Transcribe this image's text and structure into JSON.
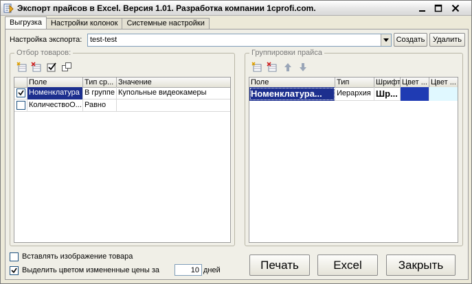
{
  "window": {
    "title": "Экспорт прайсов в Excel. Версия 1.01. Разработка компании 1cprofi.com."
  },
  "tabs": [
    {
      "label": "Выгрузка",
      "active": true
    },
    {
      "label": "Настройки колонок",
      "active": false
    },
    {
      "label": "Системные настройки",
      "active": false
    }
  ],
  "export_settings": {
    "label": "Настройка экспорта:",
    "value": "test-test",
    "create_label": "Создать",
    "delete_label": "Удалить"
  },
  "filter": {
    "title": "Отбор товаров:",
    "toolbar_icons": [
      "add-row-icon",
      "delete-row-icon",
      "check-all-icon",
      "copy-icon"
    ],
    "columns": [
      "Поле",
      "Тип ср...",
      "Значение"
    ],
    "rows": [
      {
        "checked": true,
        "field": "Номенклатура",
        "type": "В группе",
        "value": "Купольные видеокамеры",
        "selected": true
      },
      {
        "checked": false,
        "field": "КоличествоО...",
        "type": "Равно",
        "value": "",
        "selected": false
      }
    ]
  },
  "grouping": {
    "title": "Группировки прайса",
    "toolbar_icons": [
      "add-row-icon",
      "delete-row-icon",
      "arrow-up-icon",
      "arrow-down-icon"
    ],
    "columns": [
      "Поле",
      "Тип",
      "Шрифт",
      "Цвет ...",
      "Цвет ..."
    ],
    "rows": [
      {
        "field": "Номенклатура...",
        "type": "Иерархия",
        "font": "Шр...",
        "color1": "#1f3bb3",
        "color2": "#e0f8ff"
      }
    ]
  },
  "options": {
    "insert_image_label": "Вставлять изображение товара",
    "insert_image_checked": false,
    "highlight_label": "Выделить цветом измененные цены за",
    "highlight_checked": true,
    "days_value": "10",
    "days_label": "дней"
  },
  "actions": {
    "print_label": "Печать",
    "excel_label": "Excel",
    "close_label": "Закрыть"
  },
  "colors": {
    "selection": "#1c2f8e",
    "grid_header": "#e4e2d6"
  }
}
